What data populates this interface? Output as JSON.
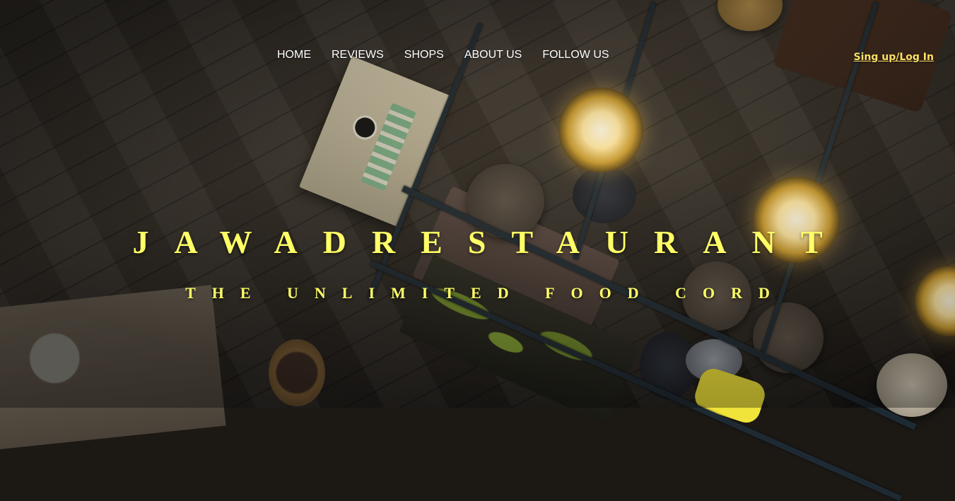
{
  "nav": {
    "items": [
      {
        "label": "HOME"
      },
      {
        "label": "REVIEWS"
      },
      {
        "label": "SHOPS"
      },
      {
        "label": "ABOUT US"
      },
      {
        "label": "FOLLOW US"
      }
    ],
    "login_label": "Sing up/Log In"
  },
  "hero": {
    "title": "JAWADRESTAURANT",
    "subtitle": "THE UNLIMITED FOOD CORD"
  },
  "colors": {
    "title": "#ffff66",
    "nav_text": "#ffffff",
    "login_text": "#ffe066"
  }
}
